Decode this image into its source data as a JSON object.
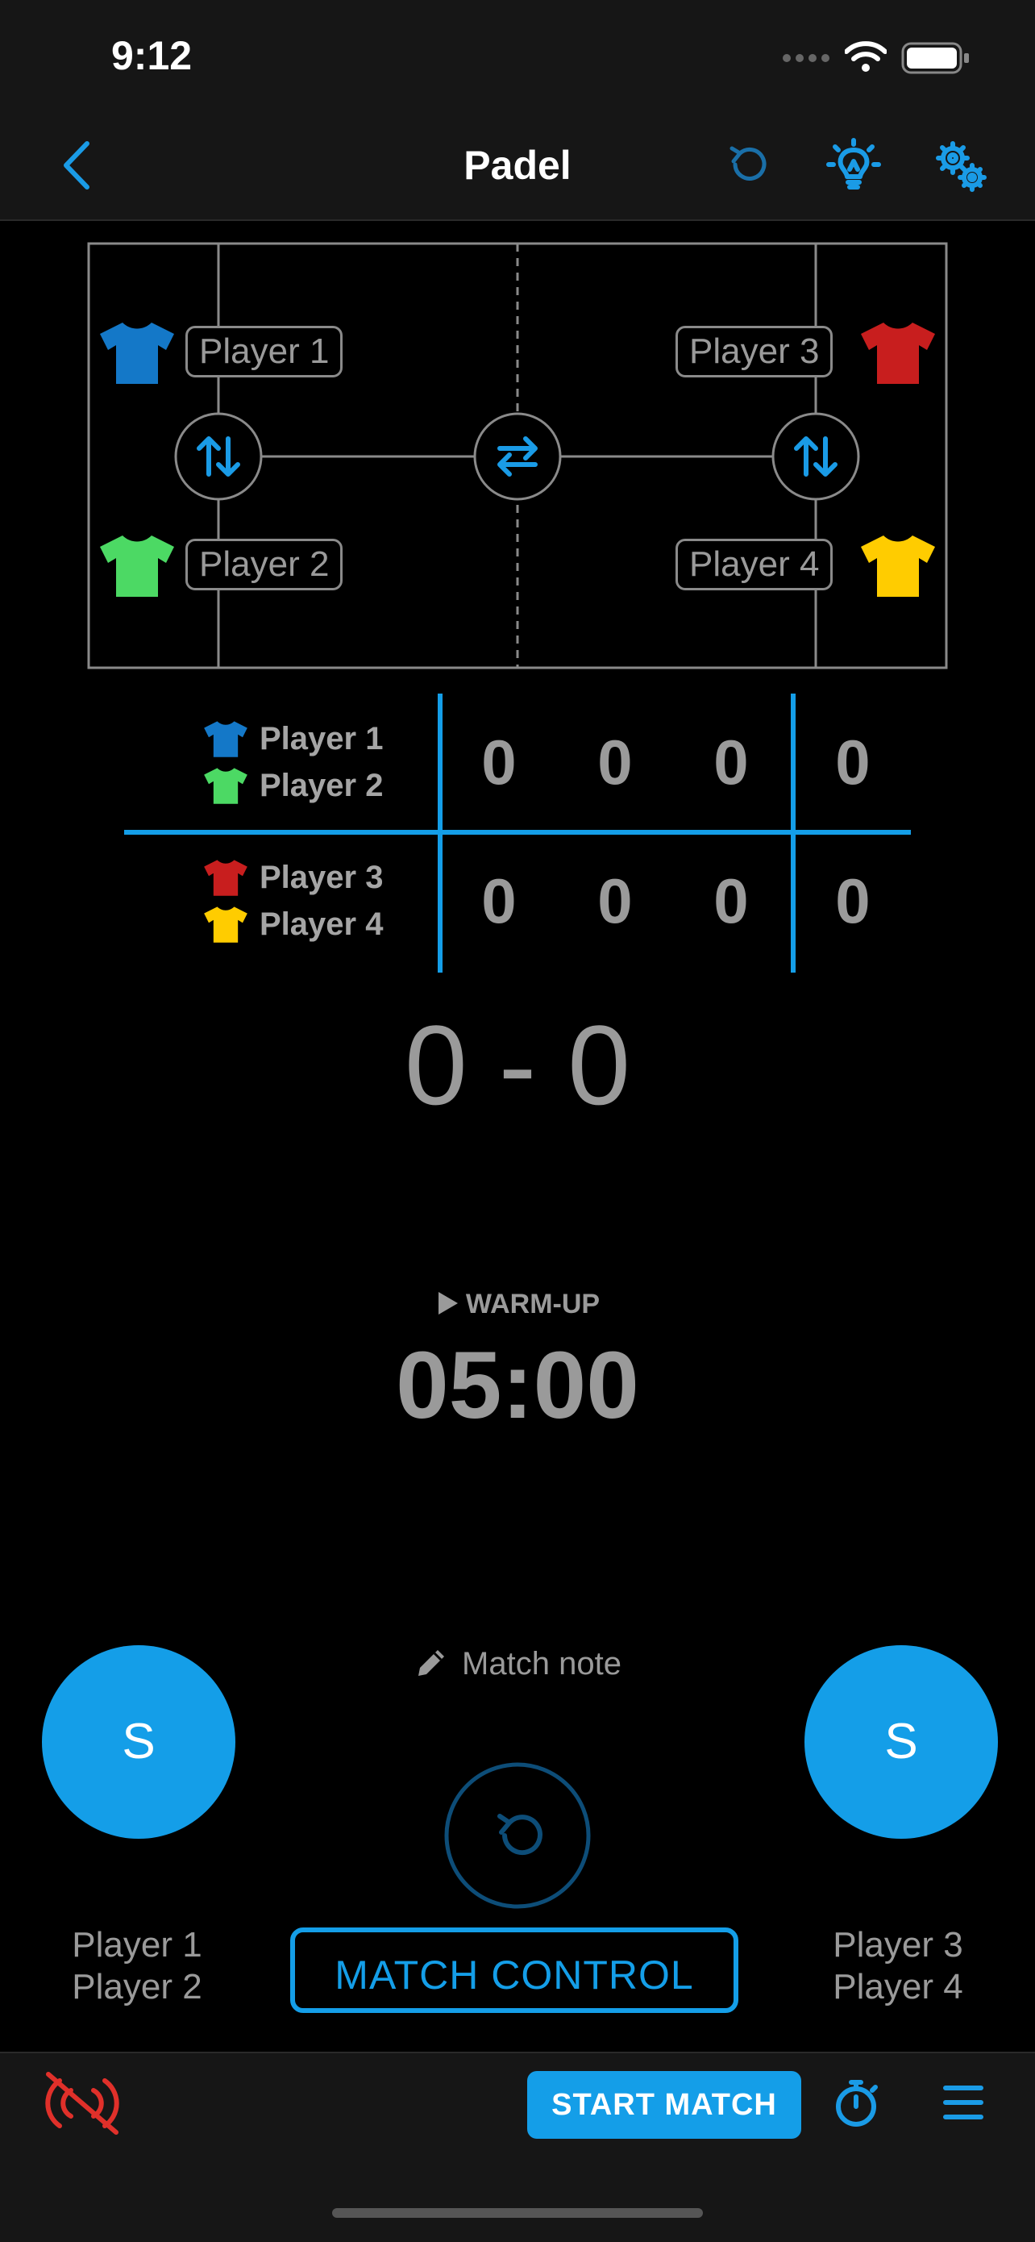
{
  "status_bar": {
    "time": "9:12"
  },
  "nav": {
    "title": "Padel"
  },
  "court": {
    "players": {
      "p1": "Player 1",
      "p2": "Player 2",
      "p3": "Player 3",
      "p4": "Player 4"
    },
    "shirt_colors": {
      "p1": "#1478c8",
      "p2": "#4cd964",
      "p3": "#c81e1e",
      "p4": "#ffcc00"
    }
  },
  "scoreboard": {
    "team1": {
      "names": [
        "Player 1",
        "Player 2"
      ],
      "sets": [
        "0",
        "0",
        "0"
      ],
      "points": "0"
    },
    "team2": {
      "names": [
        "Player 3",
        "Player 4"
      ],
      "sets": [
        "0",
        "0",
        "0"
      ],
      "points": "0"
    }
  },
  "games_score": "0 - 0",
  "timer": {
    "label": "WARM-UP",
    "value": "05:00"
  },
  "match_note": "Match note",
  "serve": {
    "left": "S",
    "right": "S"
  },
  "teams_bottom": {
    "left": {
      "line1": "Player 1",
      "line2": "Player 2"
    },
    "right": {
      "line1": "Player 3",
      "line2": "Player 4"
    }
  },
  "buttons": {
    "match_control": "MATCH CONTROL",
    "start_match": "START MATCH"
  },
  "colors": {
    "accent": "#149ee8",
    "muted_text": "#9a9a9a",
    "mute_icon": "#e0302a"
  }
}
